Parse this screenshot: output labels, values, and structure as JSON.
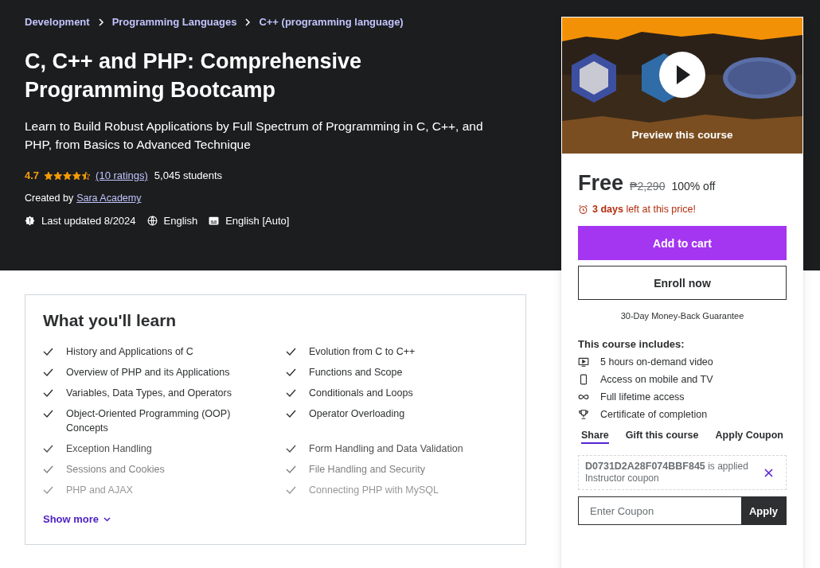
{
  "breadcrumbs": [
    "Development",
    "Programming Languages",
    "C++ (programming language)"
  ],
  "title": "C, C++ and PHP: Comprehensive Programming Bootcamp",
  "subtitle": "Learn to Build Robust Applications by Full Spectrum of Programming in C, C++, and PHP, from Basics to Advanced Technique",
  "rating": {
    "value": "4.7",
    "stars": 4.5,
    "ratings_link": "(10 ratings)",
    "students": "5,045 students"
  },
  "created_by": {
    "label": "Created by",
    "author": "Sara Academy"
  },
  "meta": [
    {
      "kind": "updated",
      "text": "Last updated 8/2024"
    },
    {
      "kind": "language",
      "text": "English"
    },
    {
      "kind": "captions",
      "text": "English [Auto]"
    }
  ],
  "learn": {
    "heading": "What you'll learn",
    "items": [
      {
        "text": "History and Applications of C"
      },
      {
        "text": "Evolution from C to C++"
      },
      {
        "text": "Overview of PHP and its Applications"
      },
      {
        "text": "Functions and Scope"
      },
      {
        "text": "Variables, Data Types, and Operators"
      },
      {
        "text": "Conditionals and Loops"
      },
      {
        "text": "Object-Oriented Programming (OOP) Concepts"
      },
      {
        "text": "Operator Overloading"
      },
      {
        "text": "Exception Handling"
      },
      {
        "text": "Form Handling and Data Validation"
      },
      {
        "text": "Sessions and Cookies"
      },
      {
        "text": "File Handling and Security"
      },
      {
        "text": "PHP and AJAX"
      },
      {
        "text": "Connecting PHP with MySQL"
      }
    ],
    "show_more": "Show more"
  },
  "sidebar": {
    "preview": {
      "kind": "picture",
      "label": "Preview this course"
    },
    "price": "Free",
    "original_price": "₱2,290",
    "discount": "100% off",
    "deadline": "**3 days** left at this price!",
    "add_to_cart": "Add to cart",
    "enroll": "Enroll now",
    "guarantee": "30-Day Money-Back Guarantee",
    "includes_heading": "This course includes:",
    "includes": [
      {
        "kind": "video",
        "text": "5 hours on-demand video"
      },
      {
        "kind": "mobile",
        "text": "Access on mobile and TV"
      },
      {
        "kind": "lifetime",
        "text": "Full lifetime access"
      },
      {
        "kind": "certificate",
        "text": "Certificate of completion"
      }
    ],
    "actions": [
      {
        "label": "Share",
        "selected": true
      },
      {
        "label": "Gift this course",
        "selected": false
      },
      {
        "label": "Apply Coupon",
        "selected": false
      }
    ],
    "coupon": {
      "code": "D0731D2A28F074BBF845",
      "status": "is applied",
      "type": "Instructor coupon"
    },
    "coupon_input": {
      "placeholder": "Enter Coupon"
    },
    "apply": "Apply"
  }
}
